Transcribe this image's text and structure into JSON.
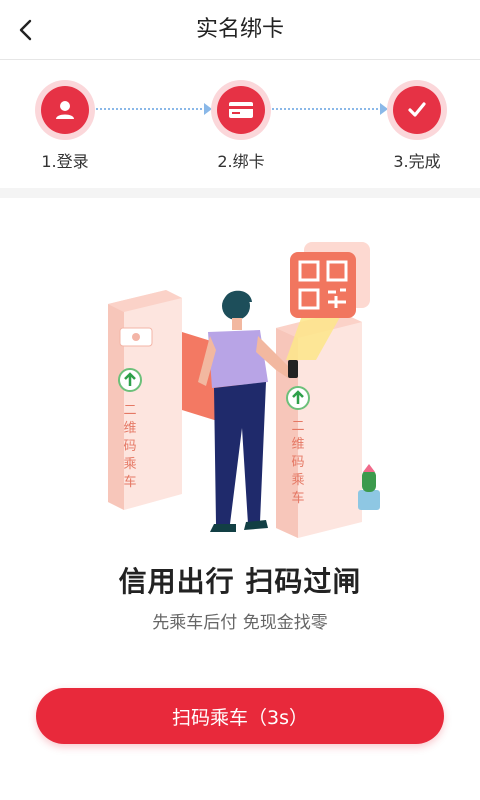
{
  "header": {
    "title": "实名绑卡",
    "back_icon": "chevron-left-icon"
  },
  "steps": [
    {
      "label": "1.登录",
      "icon": "user-icon"
    },
    {
      "label": "2.绑卡",
      "icon": "card-icon"
    },
    {
      "label": "3.完成",
      "icon": "check-icon"
    }
  ],
  "illustration": {
    "gate_text_left": "二维码乘车",
    "gate_text_right": "二维码乘车"
  },
  "promo": {
    "headline": "信用出行 扫码过闸",
    "subline": "先乘车后付  免现金找零"
  },
  "cta": {
    "label": "扫码乘车（3s）"
  },
  "colors": {
    "accent": "#e8293b",
    "step_ring": "#fbd7da",
    "step_line": "#8ab8e8"
  }
}
